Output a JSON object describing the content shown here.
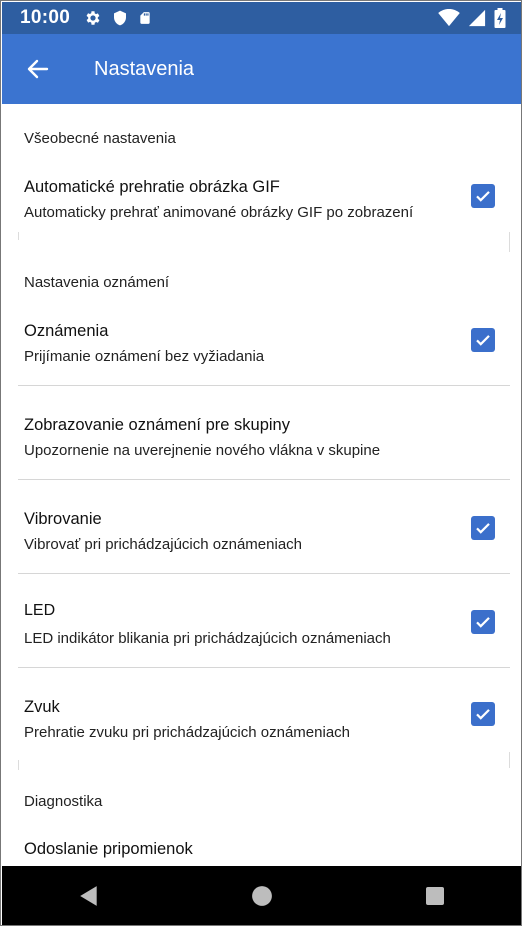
{
  "status_bar": {
    "time": "10:00",
    "left_icons": [
      "gear-icon",
      "shield-icon",
      "sd-card-icon"
    ],
    "right_icons": [
      "wifi-icon",
      "signal-icon",
      "battery-icon"
    ]
  },
  "app_bar": {
    "title": "Nastavenia",
    "back_icon": "arrow-left-icon"
  },
  "sections": {
    "general": {
      "header": "Všeobecné nastavenia",
      "gif": {
        "title": "Automatické prehratie obrázka GIF",
        "subtitle": "Automaticky prehrať animované obrázky GIF po zobrazení",
        "checked": true
      }
    },
    "notifications": {
      "header": "Nastavenia oznámení",
      "items": [
        {
          "title": "Oznámenia",
          "subtitle": "Prijímanie oznámení bez vyžiadania",
          "checked": true
        },
        {
          "title": "Zobrazovanie oznámení pre skupiny",
          "subtitle": "Upozornenie na uverejnenie nového vlákna v skupine",
          "checked": false
        },
        {
          "title": "Vibrovanie",
          "subtitle": "Vibrovať pri prichádzajúcich oznámeniach",
          "checked": true
        },
        {
          "title": "LED",
          "subtitle": "LED indikátor blikania pri prichádzajúcich oznámeniach",
          "checked": true
        },
        {
          "title": "Zvuk",
          "subtitle": "Prehratie zvuku pri prichádzajúcich oznámeniach",
          "checked": true
        }
      ]
    },
    "diagnostics": {
      "header": "Diagnostika",
      "feedback": {
        "title": "Odoslanie pripomienok"
      }
    }
  },
  "nav_bar": {
    "buttons": [
      "back-triangle-icon",
      "home-circle-icon",
      "recents-square-icon"
    ]
  },
  "colors": {
    "status_bar": "#2e5ea1",
    "app_bar": "#3b74d0",
    "checkbox": "#3b6fcb"
  }
}
